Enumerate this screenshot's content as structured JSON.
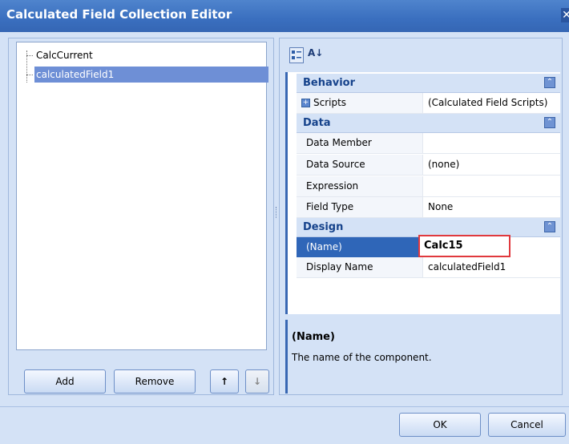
{
  "window": {
    "title": "Calculated Field Collection Editor",
    "close_glyph": "✕"
  },
  "tree": {
    "items": [
      {
        "label": "CalcCurrent",
        "selected": false
      },
      {
        "label": "calculatedField1",
        "selected": true
      }
    ]
  },
  "left_buttons": {
    "add": "Add",
    "remove": "Remove",
    "move_up": "↑",
    "move_down": "↓"
  },
  "toolbar": {
    "categorized_icon": "categorized-icon",
    "alphabetical_icon": "alphabetical-sort-icon",
    "alpha_glyph": "A↓"
  },
  "property_grid": {
    "categories": [
      {
        "name": "Behavior",
        "properties": [
          {
            "name": "Scripts",
            "value": "(Calculated Field Scripts)",
            "expandable": true
          }
        ]
      },
      {
        "name": "Data",
        "properties": [
          {
            "name": "Data Member",
            "value": ""
          },
          {
            "name": "Data Source",
            "value": "(none)"
          },
          {
            "name": "Expression",
            "value": ""
          },
          {
            "name": "Field Type",
            "value": "None"
          }
        ]
      },
      {
        "name": "Design",
        "properties": [
          {
            "name": "(Name)",
            "value": "Calc15",
            "selected": true
          },
          {
            "name": "Display Name",
            "value": "calculatedField1"
          }
        ]
      }
    ]
  },
  "description": {
    "title": "(Name)",
    "text": "The name of the component."
  },
  "dialog_buttons": {
    "ok": "OK",
    "cancel": "Cancel"
  },
  "colors": {
    "accent": "#3867b3",
    "highlight_box": "#e0393e",
    "selection": "#2f66b8"
  }
}
